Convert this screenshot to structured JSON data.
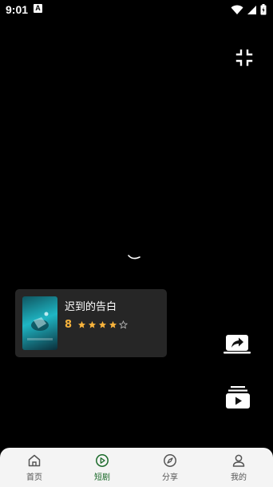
{
  "status_bar": {
    "time": "9:01",
    "app_badge": "A"
  },
  "drama_card": {
    "title": "迟到的告白",
    "score": "8",
    "rating_stars": 4,
    "rating_max": 5
  },
  "tab_bar": {
    "tabs": [
      {
        "label": "首页",
        "icon": "home-icon",
        "active": false
      },
      {
        "label": "短剧",
        "icon": "play-circle-icon",
        "active": true
      },
      {
        "label": "分享",
        "icon": "compass-icon",
        "active": false
      },
      {
        "label": "我的",
        "icon": "user-icon",
        "active": false
      }
    ]
  },
  "colors": {
    "accent": "#1b6a2a",
    "score": "#f7b33c",
    "card_bg": "#262626",
    "tab_bar_bg": "#f4f4f4"
  }
}
